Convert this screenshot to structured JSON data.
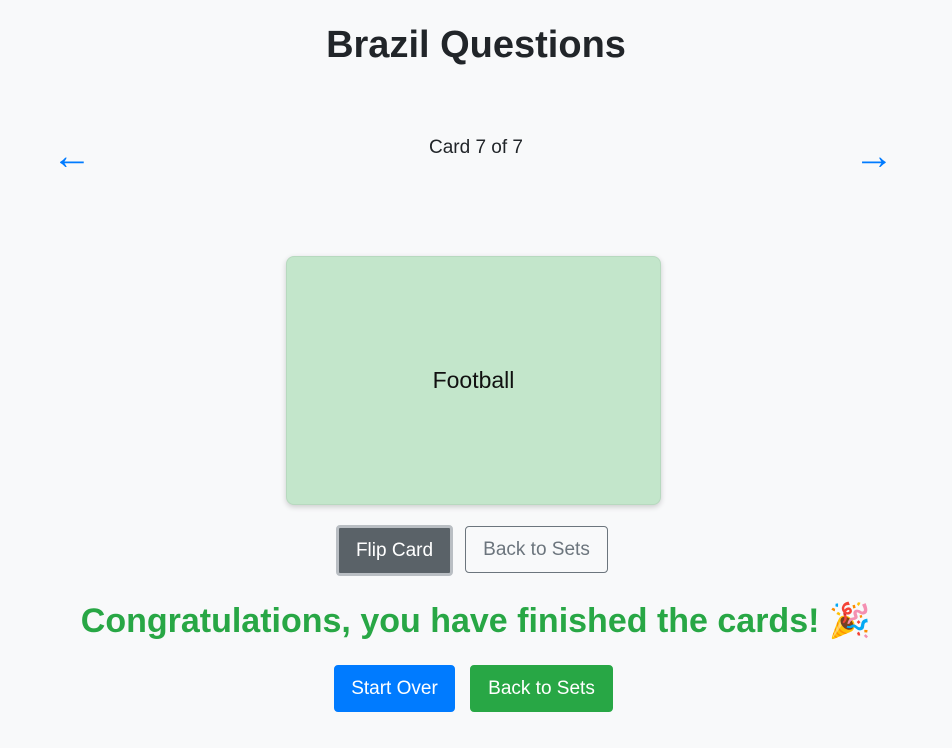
{
  "page": {
    "title": "Brazil Questions"
  },
  "nav": {
    "prev_icon": "←",
    "next_icon": "→",
    "counter": "Card 7 of 7"
  },
  "card": {
    "text": "Football"
  },
  "card_actions": {
    "flip_label": "Flip Card",
    "back_label": "Back to Sets"
  },
  "completion": {
    "message": "Congratulations, you have finished the cards! 🎉",
    "start_over_label": "Start Over",
    "back_label": "Back to Sets"
  },
  "colors": {
    "accent_blue": "#007bff",
    "success_green": "#28a745",
    "card_background": "#c3e6cb",
    "secondary_gray": "#6c757d"
  }
}
